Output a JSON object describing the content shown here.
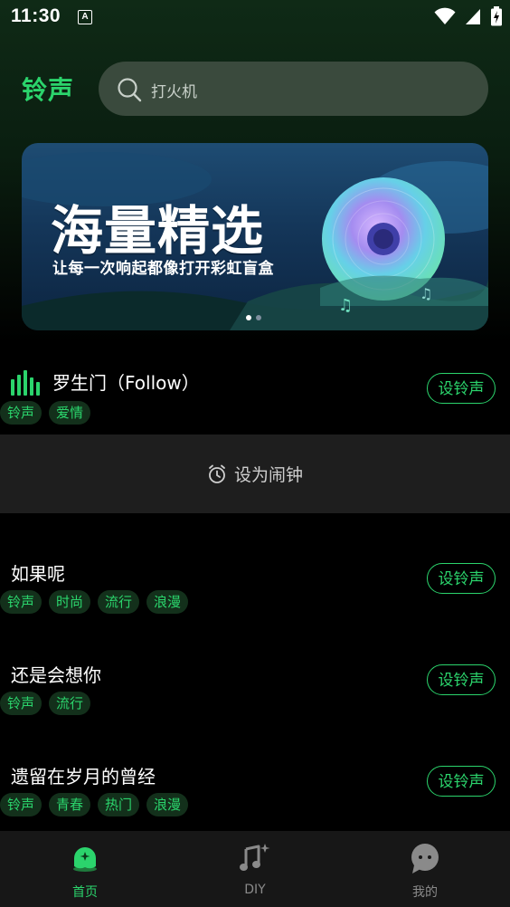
{
  "status_bar": {
    "time": "11:30",
    "notif_letter": "A"
  },
  "header": {
    "brand": "铃声",
    "search_placeholder": "打火机"
  },
  "banner": {
    "title": "海量精选",
    "subtitle": "让每一次响起都像打开彩虹盲盒",
    "page_count": 2,
    "active_page": 1
  },
  "current_item": {
    "title": "罗生门（Follow）",
    "tags": [
      "铃声",
      "爱情"
    ],
    "button": "设铃声"
  },
  "alarm_action": {
    "label": "设为闹钟"
  },
  "items": [
    {
      "title": "如果呢",
      "tags": [
        "铃声",
        "时尚",
        "流行",
        "浪漫"
      ],
      "button": "设铃声"
    },
    {
      "title": "还是会想你",
      "tags": [
        "铃声",
        "流行"
      ],
      "button": "设铃声"
    },
    {
      "title": "遗留在岁月的曾经",
      "tags": [
        "铃声",
        "青春",
        "热门",
        "浪漫"
      ],
      "button": "设铃声"
    }
  ],
  "bottom_nav": [
    {
      "label": "首页",
      "icon": "home-ghost-icon",
      "active": true
    },
    {
      "label": "DIY",
      "icon": "music-note-sparkle-icon",
      "active": false
    },
    {
      "label": "我的",
      "icon": "chat-bubble-icon",
      "active": false
    }
  ],
  "colors": {
    "accent": "#2bd46c",
    "tag_bg": "#13301b",
    "alarm_bg": "#1e1e1e",
    "nav_bg": "#171717"
  }
}
